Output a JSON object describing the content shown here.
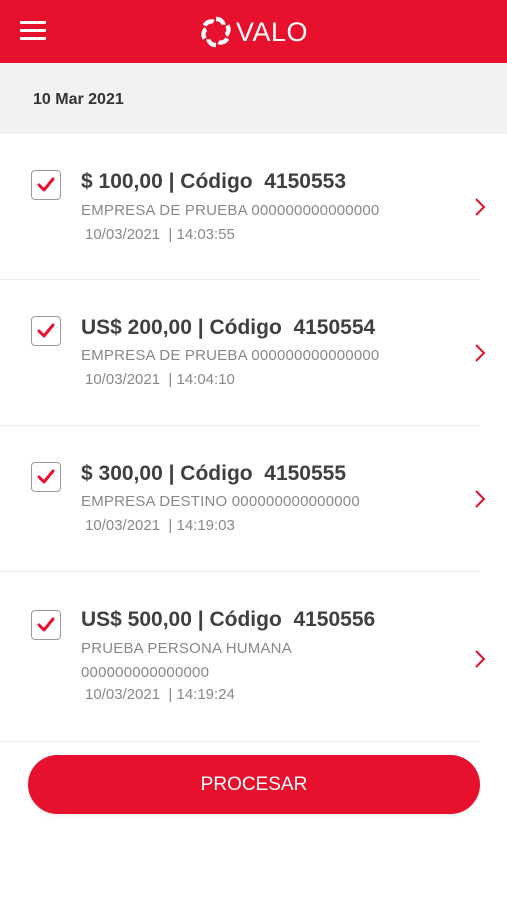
{
  "header": {
    "menu_icon": "hamburger-menu-icon",
    "logo_icon": "valo-spiral-logo",
    "logo_text": "VALO",
    "brand_color": "#e8112d"
  },
  "date_header": "10 Mar 2021",
  "items": [
    {
      "checked": true,
      "title": "$ 100,00 | Código  4150553",
      "company": "EMPRESA DE PRUEBA 000000000000000",
      "datetime": "10/03/2021  | 14:03:55"
    },
    {
      "checked": true,
      "title": "US$ 200,00 | Código  4150554",
      "company": "EMPRESA DE PRUEBA 000000000000000",
      "datetime": "10/03/2021  | 14:04:10"
    },
    {
      "checked": true,
      "title": "$ 300,00 | Código  4150555",
      "company": "EMPRESA DESTINO 000000000000000",
      "datetime": "10/03/2021  | 14:19:03"
    },
    {
      "checked": true,
      "title": "US$ 500,00 | Código  4150556",
      "company": "PRUEBA PERSONA HUMANA 000000000000000",
      "datetime": "10/03/2021  | 14:19:24"
    }
  ],
  "process_button": "PROCESAR"
}
